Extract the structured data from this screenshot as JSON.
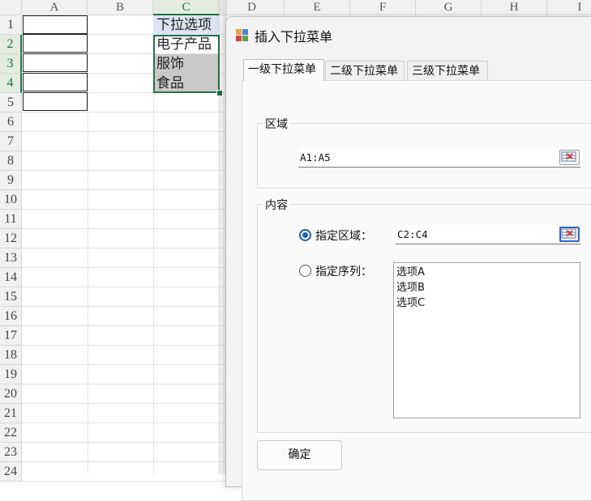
{
  "spreadsheet": {
    "columns": [
      "A",
      "B",
      "C",
      "D",
      "E",
      "F",
      "G",
      "H",
      "I"
    ],
    "rows": [
      "1",
      "2",
      "3",
      "4",
      "5",
      "6",
      "7",
      "8",
      "9",
      "10",
      "11",
      "12",
      "13",
      "14",
      "15",
      "16",
      "17",
      "18",
      "19",
      "20",
      "21",
      "22",
      "23",
      "24"
    ],
    "column_c_cells": [
      "下拉选项",
      "电子产品",
      "服饰",
      "食品"
    ]
  },
  "dialog": {
    "title": "插入下拉菜单",
    "tabs": [
      "一级下拉菜单",
      "二级下拉菜单",
      "三级下拉菜单"
    ],
    "area_group": {
      "title": "区域",
      "range_value": "A1:A5"
    },
    "content_group": {
      "title": "内容",
      "range_option": {
        "label": "指定区域：",
        "value": "C2:C4",
        "selected": true
      },
      "sequence_option": {
        "label": "指定序列：",
        "selected": false,
        "items": [
          "选项A",
          "选项B",
          "选项C"
        ]
      }
    },
    "ok_label": "确定"
  },
  "colors": {
    "selection_green": "#217346",
    "radio_blue": "#1f5fb8"
  },
  "icons": [
    "app-icon",
    "range-select-icon"
  ]
}
